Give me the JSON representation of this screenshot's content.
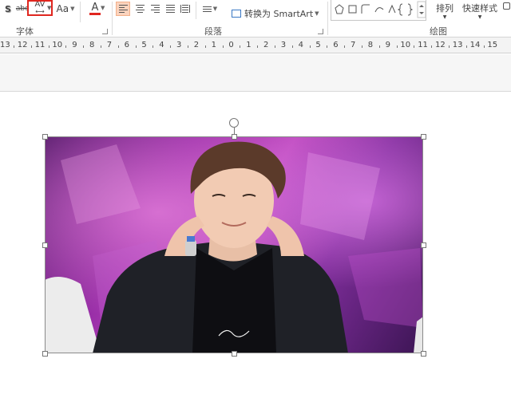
{
  "ribbon": {
    "font_group": {
      "label": "字体",
      "shadow_glyph": "S",
      "strike_glyph": "abc",
      "spacing_glyph": "AV",
      "case_glyph": "Aa",
      "color_glyph": "A"
    },
    "paragraph_group": {
      "label": "段落",
      "smartart_label": "转换为 SmartArt"
    },
    "drawing_group": {
      "label": "绘图",
      "arrange_label": "排列",
      "quick_styles_label": "快速样式"
    }
  },
  "ruler": {
    "ticks": [
      "13",
      "12",
      "11",
      "10",
      "9",
      "8",
      "7",
      "6",
      "5",
      "4",
      "3",
      "2",
      "1",
      "0",
      "1",
      "2",
      "3",
      "4",
      "5",
      "6",
      "7",
      "8",
      "9",
      "10",
      "11",
      "12",
      "13",
      "14",
      "15"
    ]
  },
  "colors": {
    "highlight": "#e0261f",
    "align_active": "#fbd3bd",
    "font_color_bar": "#e0261f"
  }
}
